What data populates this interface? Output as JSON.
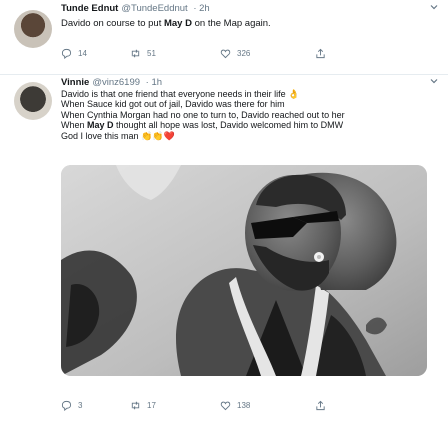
{
  "tweets": [
    {
      "name": "Tunde Ednut",
      "handle": "@TundeEddnut",
      "time": "· 2h",
      "text_pre": "Davido on course to put ",
      "text_bold": "May D",
      "text_post": " on the Map again.",
      "replies": "14",
      "retweets": "51",
      "likes": "326"
    },
    {
      "name": "Vinnie",
      "handle": "@vinz6199",
      "time": "· 1h",
      "lines": [
        "Davido is that one friend that everyone needs in their life 👌",
        "When Sauce kid got out of jail, Davido was there for him",
        "When Cynthia Morgan had no one to turn to, Davido reached out to her"
      ],
      "line4_pre": "When ",
      "line4_bold": "May D",
      "line4_post": " thought all hope was lost, Davido welcomed him to DMW",
      "line5": "God I love this man 👏👏❤️",
      "replies": "3",
      "retweets": "17",
      "likes": "138"
    }
  ]
}
